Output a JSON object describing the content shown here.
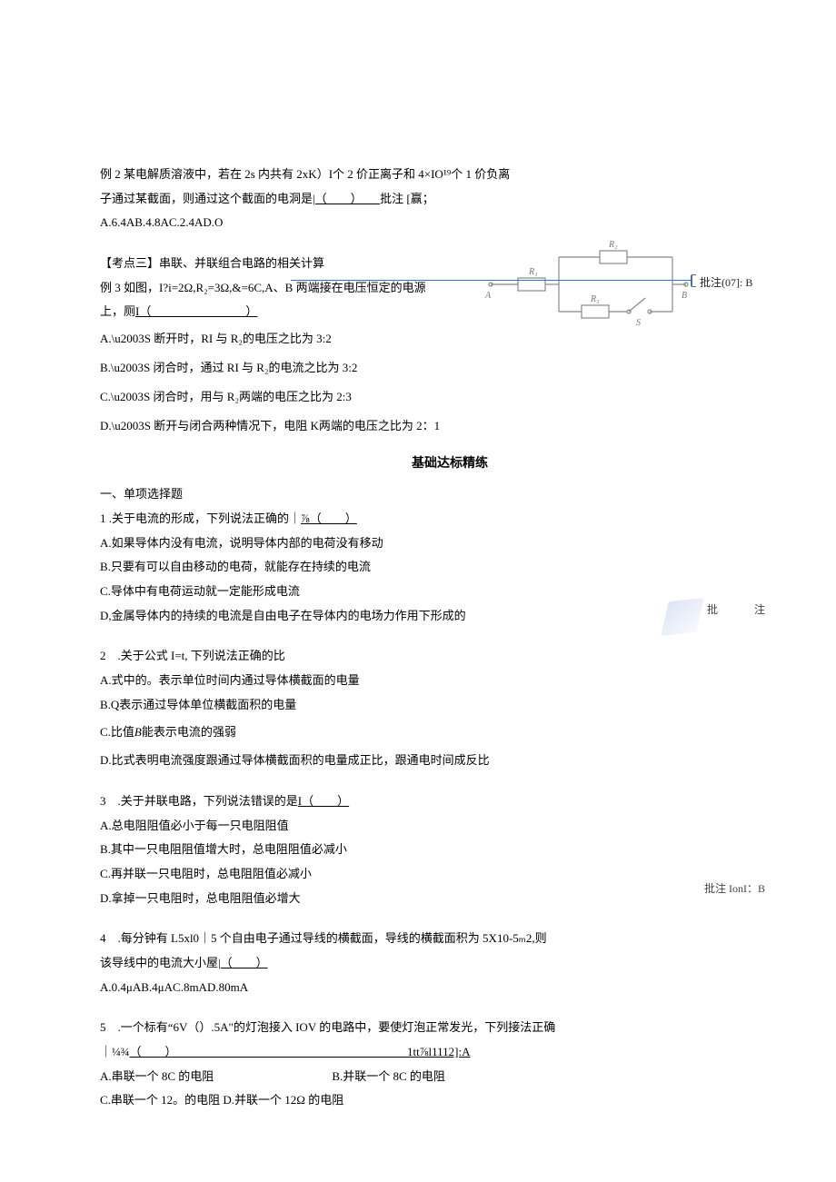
{
  "example2": {
    "line1": "例 2 某电解质溶液中，若在 2s 内共有 2xK）I个 2 价正离子和 4×IO¹⁹个 1 价负离",
    "line2_prefix": "子通过某截面，则通过这个截面的电洞是",
    "line2_blank": "|（　　）　　",
    "line2_suffix": "批注 [赢；",
    "options": "A.6.4AB.4.8AC.2.4AD.O"
  },
  "kp3": {
    "title": "【考点三】串联、并联组合电路的相关计算",
    "stem_line1": "例 3 如图，I?i=2Ω,R₂=3Ω,&=6C,A、B 两端接在电压恒定的电源",
    "stem_line2_prefix": "上，厕",
    "stem_line2_blank": "I（　　　　　　　　）",
    "optA": "S 断开时，RI 与 R₂的电压之比为 3:2",
    "optB": "S 闭合时，通过 RI 与 R₂的电流之比为 3:2",
    "optC": "S 闭合时，用与 R₂两端的电压之比为 2:3",
    "optD": "S 断开与闭合两种情况下，电阻 K两端的电压之比为 2：1"
  },
  "comment07": "批注(07]: B",
  "section_title": "基础达标精练",
  "practice_heading": "一、单项选择题",
  "q1": {
    "stem_prefix": "1 .关于电流的形成，下列说法正确的｜",
    "stem_blank": "⅞（　　）",
    "A": "A.如果导体内没有电流，说明导体内部的电荷没有移动",
    "B": "B.只要有可以自由移动的电荷，就能存在持续的电流",
    "C": "C.导体中有电荷运动就一定能形成电流",
    "D": "D,金属导体内的持续的电流是自由电子在导体内的电场力作用下形成的"
  },
  "q2": {
    "stem": "2　.关于公式 I=t, 下列说法正确的比",
    "A": "A.式中的。表示单位时间内通过导体横截面的电量",
    "B": "B.Q表示通过导体单位横截面积的电量",
    "C_prefix": "C.比值",
    "C_mid": "B",
    "C_suffix": "能表示电流的强弱",
    "D": "D.比式表明电流强度跟通过导体横截面积的电量成正比，跟通电时间成反比"
  },
  "annot2": {
    "label1": "批",
    "label2": "注"
  },
  "q3": {
    "stem_prefix": "3　.关于并联电路，下列说法错误的是",
    "stem_blank": "I（　　）",
    "A": "A.总电阻阻值必小于每一只电阻阻值",
    "B": "B.其中一只电阻阻值增大时，总电阻阻值必减小",
    "C": "C.再并联一只电阻时，总电阻阻值必减小",
    "D": "D.拿掉一只电阻时，总电阻阻值必增大"
  },
  "q4": {
    "line1": "4　.每分钟有 L5xl0｜5 个自由电子通过导线的横截面，导线的横截面积为 5X10-5ₘ2,则",
    "line2_prefix": "该导线中的电流大小屋",
    "line2_blank": "|（　　）",
    "options": "A.0.4μAB.4μAC.8mAD.80mA"
  },
  "comment_q4": "批注 IonI：B",
  "q5": {
    "line1": "5　.一个标有“6V（）.5A\"的灯泡接入 IOV 的电路中，要使灯泡正常发光，下列接法正确",
    "line2_prefix": "｜¼¾",
    "line2_blank": "（　　）",
    "line2_suffix": "　　　　　　　　　　　　　　　　　　　　1tt⅞l1112]:A",
    "A": "A.串联一个 8C 的电阻",
    "B": "B.并联一个 8C 的电阻",
    "C": "C.串联一个 12。的电阻 D.并联一个 12Ω 的电阻"
  },
  "circuit_labels": {
    "R1": "R₁",
    "R2": "R₂",
    "R3": "R₃",
    "S": "S",
    "A": "A",
    "B": "B"
  }
}
